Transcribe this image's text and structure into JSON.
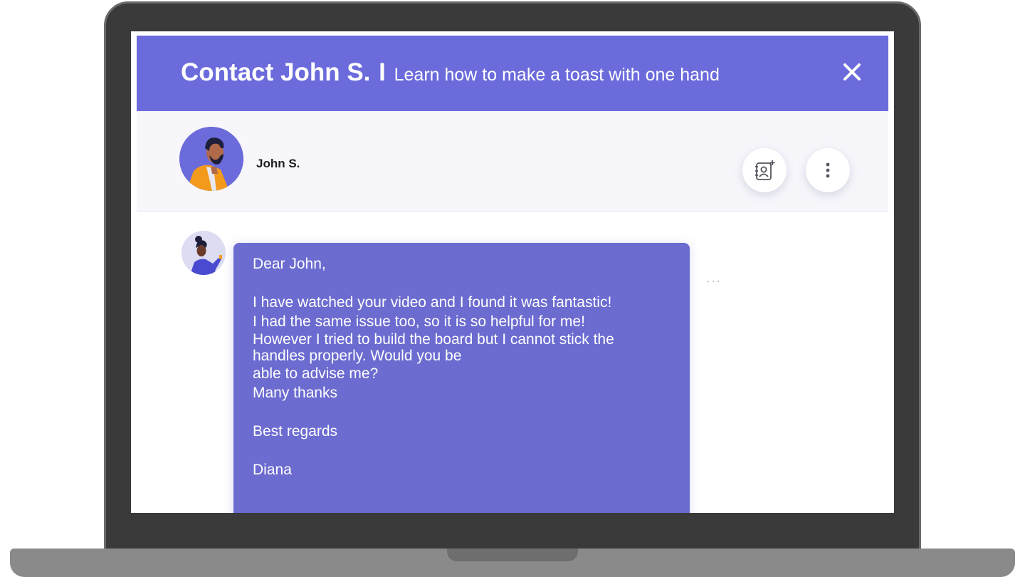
{
  "header": {
    "contact_title": "Contact John S.",
    "separator": "I",
    "subtitle": "Learn how to make a toast with one hand",
    "close_icon": "close-icon"
  },
  "contact": {
    "name": "John S.",
    "avatar_icon": "avatar",
    "actions": [
      {
        "icon": "add-contact-icon"
      },
      {
        "icon": "more-vertical-icon"
      }
    ]
  },
  "message": {
    "sender_avatar_icon": "avatar",
    "greeting": "Dear John,",
    "line1": "I have watched your video and I found it was fantastic!",
    "line2": "I had the same issue too, so it is so helpful for me!",
    "line3": "However I tried to build the board but I cannot stick the",
    "line4": "handles properly. Would you be",
    "line5": "able to advise me?",
    "line6": "Many thanks",
    "closing": "Best regards",
    "signature": "Diana",
    "more_label": "···"
  },
  "colors": {
    "accent": "#6b6bdc",
    "bubble": "#6b6bd0",
    "contact_bg": "#f6f6fb",
    "avatar_orange": "#f39a1d"
  }
}
